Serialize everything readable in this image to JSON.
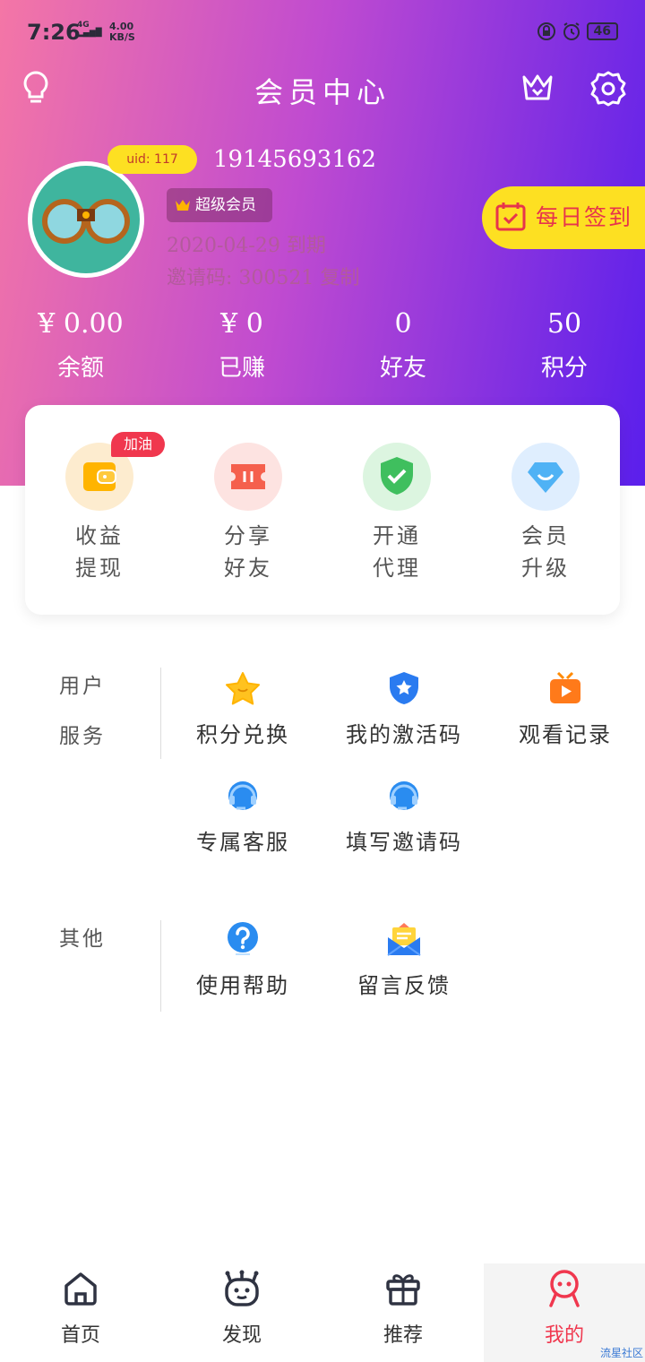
{
  "status": {
    "time": "7:26",
    "net": "4G",
    "speed_value": "4.00",
    "speed_unit": "KB/S",
    "battery": "46"
  },
  "header": {
    "title": "会员中心",
    "icons": [
      "lightbulb-icon",
      "crown-icon",
      "gear-icon"
    ]
  },
  "profile": {
    "uid": "uid: 117",
    "phone": "19145693162",
    "vip_label": "超级会员",
    "expire": "2020-04-29 到期",
    "invite": "邀请码: 300521 复制"
  },
  "checkin": {
    "label": "每日签到"
  },
  "stats": [
    {
      "value": "¥ 0.00",
      "label": "余额"
    },
    {
      "value": "¥ 0",
      "label": "已赚"
    },
    {
      "value": "0",
      "label": "好友"
    },
    {
      "value": "50",
      "label": "积分"
    }
  ],
  "quick_actions": {
    "badge": "加油",
    "items": [
      {
        "line1": "收益",
        "line2": "提现"
      },
      {
        "line1": "分享",
        "line2": "好友"
      },
      {
        "line1": "开通",
        "line2": "代理"
      },
      {
        "line1": "会员",
        "line2": "升级"
      }
    ]
  },
  "user_service": {
    "label_line1": "用户",
    "label_line2": "服务",
    "items": [
      "积分兑换",
      "我的激活码",
      "观看记录",
      "专属客服",
      "填写邀请码"
    ]
  },
  "other": {
    "label": "其他",
    "items": [
      "使用帮助",
      "留言反馈"
    ]
  },
  "tabs": [
    "首页",
    "发现",
    "推荐",
    "我的"
  ],
  "watermark": "流星社区",
  "colors": {
    "accent": "#f0374e",
    "yellow": "#fde022",
    "gradient_start": "#f476a6",
    "gradient_end": "#5a1fec"
  }
}
